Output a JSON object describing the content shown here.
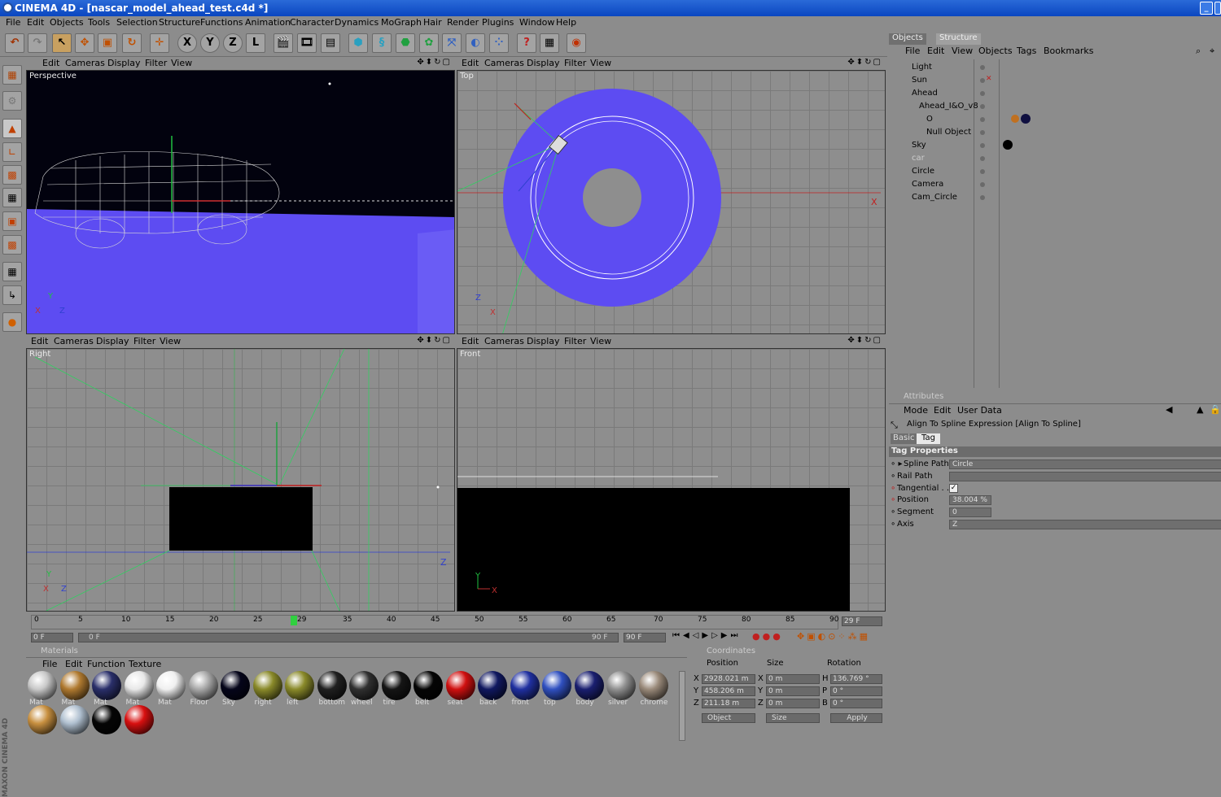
{
  "window": {
    "title": "CINEMA 4D - [nascar_model_ahead_test.c4d *]",
    "buttons": [
      "_",
      "□"
    ]
  },
  "menu": [
    "File",
    "Edit",
    "Objects",
    "Tools",
    "Selection",
    "Structure",
    "Functions",
    "Animation",
    "Character",
    "Dynamics",
    "MoGraph",
    "Hair",
    "Render",
    "Plugins",
    "Window",
    "Help"
  ],
  "viewports": [
    {
      "name": "Perspective",
      "menu": [
        "Edit",
        "Cameras",
        "Display",
        "Filter",
        "View"
      ]
    },
    {
      "name": "Top",
      "menu": [
        "Edit",
        "Cameras",
        "Display",
        "Filter",
        "View"
      ]
    },
    {
      "name": "Right",
      "menu": [
        "Edit",
        "Cameras",
        "Display",
        "Filter",
        "View"
      ]
    },
    {
      "name": "Front",
      "menu": [
        "Edit",
        "Cameras",
        "Display",
        "Filter",
        "View"
      ]
    }
  ],
  "axes": {
    "x": "X",
    "y": "Y",
    "z": "Z"
  },
  "objects_panel": {
    "tabs": [
      "Objects",
      "Structure"
    ],
    "menu": [
      "File",
      "Edit",
      "View",
      "Objects",
      "Tags",
      "Bookmarks"
    ],
    "items": [
      "Light",
      "Sun",
      "Ahead",
      "Ahead_I&O_v8",
      "O",
      "Null Object",
      "Sky",
      "car",
      "Circle",
      "Camera",
      "Cam_Circle"
    ]
  },
  "attributes": {
    "header": "Attributes",
    "menu": [
      "Mode",
      "Edit",
      "User Data"
    ],
    "title": "Align To Spline Expression [Align To Spline]",
    "tabs": [
      "Basic",
      "Tag"
    ],
    "section": "Tag Properties",
    "spline_path_label": "Spline Path",
    "spline_path_value": "Circle",
    "rail_path_label": "Rail Path",
    "tangential_label": "Tangential . .",
    "position_label": "Position",
    "position_value": "38.004 %",
    "segment_label": "Segment",
    "segment_value": "0",
    "axis_label": "Axis",
    "axis_value": "Z"
  },
  "timeline": {
    "ticks": [
      "0",
      "5",
      "10",
      "15",
      "20",
      "25",
      "29",
      "35",
      "40",
      "45",
      "50",
      "55",
      "60",
      "65",
      "70",
      "75",
      "80",
      "85",
      "90"
    ],
    "current_frame": "29 F",
    "start": "0 F",
    "range_start": "0 F",
    "range_end": "90 F",
    "end": "90 F"
  },
  "materials": {
    "header": "Materials",
    "menu": [
      "File",
      "Edit",
      "Function",
      "Texture"
    ],
    "row1": [
      {
        "name": "Mat",
        "color": "#c8c8c8"
      },
      {
        "name": "Mat",
        "color": "#b07a30"
      },
      {
        "name": "Mat",
        "color": "#2a2f6a"
      },
      {
        "name": "Mat",
        "color": "#e8e8e8"
      },
      {
        "name": "Mat",
        "color": "#f0f0f0"
      },
      {
        "name": "Floor",
        "color": "#a8a8a8"
      },
      {
        "name": "Sky",
        "color": "#05051a"
      },
      {
        "name": "right",
        "color": "#8a8a2a"
      },
      {
        "name": "left",
        "color": "#8a8a2a"
      },
      {
        "name": "bottom",
        "color": "#202020"
      },
      {
        "name": "wheel",
        "color": "#303030"
      },
      {
        "name": "tire",
        "color": "#151515"
      },
      {
        "name": "belt",
        "color": "#050505"
      },
      {
        "name": "seat",
        "color": "#d01010"
      },
      {
        "name": "back",
        "color": "#101860"
      },
      {
        "name": "front",
        "color": "#2030a0"
      },
      {
        "name": "top",
        "color": "#3050c0"
      },
      {
        "name": "body",
        "color": "#1a1f70"
      },
      {
        "name": "silver",
        "color": "#909090"
      },
      {
        "name": "chrome",
        "color": "#9a8a7a"
      }
    ],
    "row2": [
      {
        "name": "",
        "color": "#c89040"
      },
      {
        "name": "",
        "color": "#b0c0d0"
      },
      {
        "name": "",
        "color": "#050505"
      },
      {
        "name": "",
        "color": "#d81010"
      }
    ]
  },
  "coordinates": {
    "header": "Coordinates",
    "cols": [
      "Position",
      "Size",
      "Rotation"
    ],
    "x_pos": "2928.021 m",
    "y_pos": "458.206 m",
    "z_pos": "211.18 m",
    "x_size": "0 m",
    "y_size": "0 m",
    "z_size": "0 m",
    "h": "136.769 °",
    "p": "0 °",
    "b": "0 °",
    "labels": [
      "X",
      "Y",
      "Z",
      "X",
      "Y",
      "Z",
      "H",
      "P",
      "B"
    ],
    "mode": "Object",
    "size_mode": "Size",
    "apply": "Apply"
  },
  "brand": "MAXON CINEMA 4D"
}
